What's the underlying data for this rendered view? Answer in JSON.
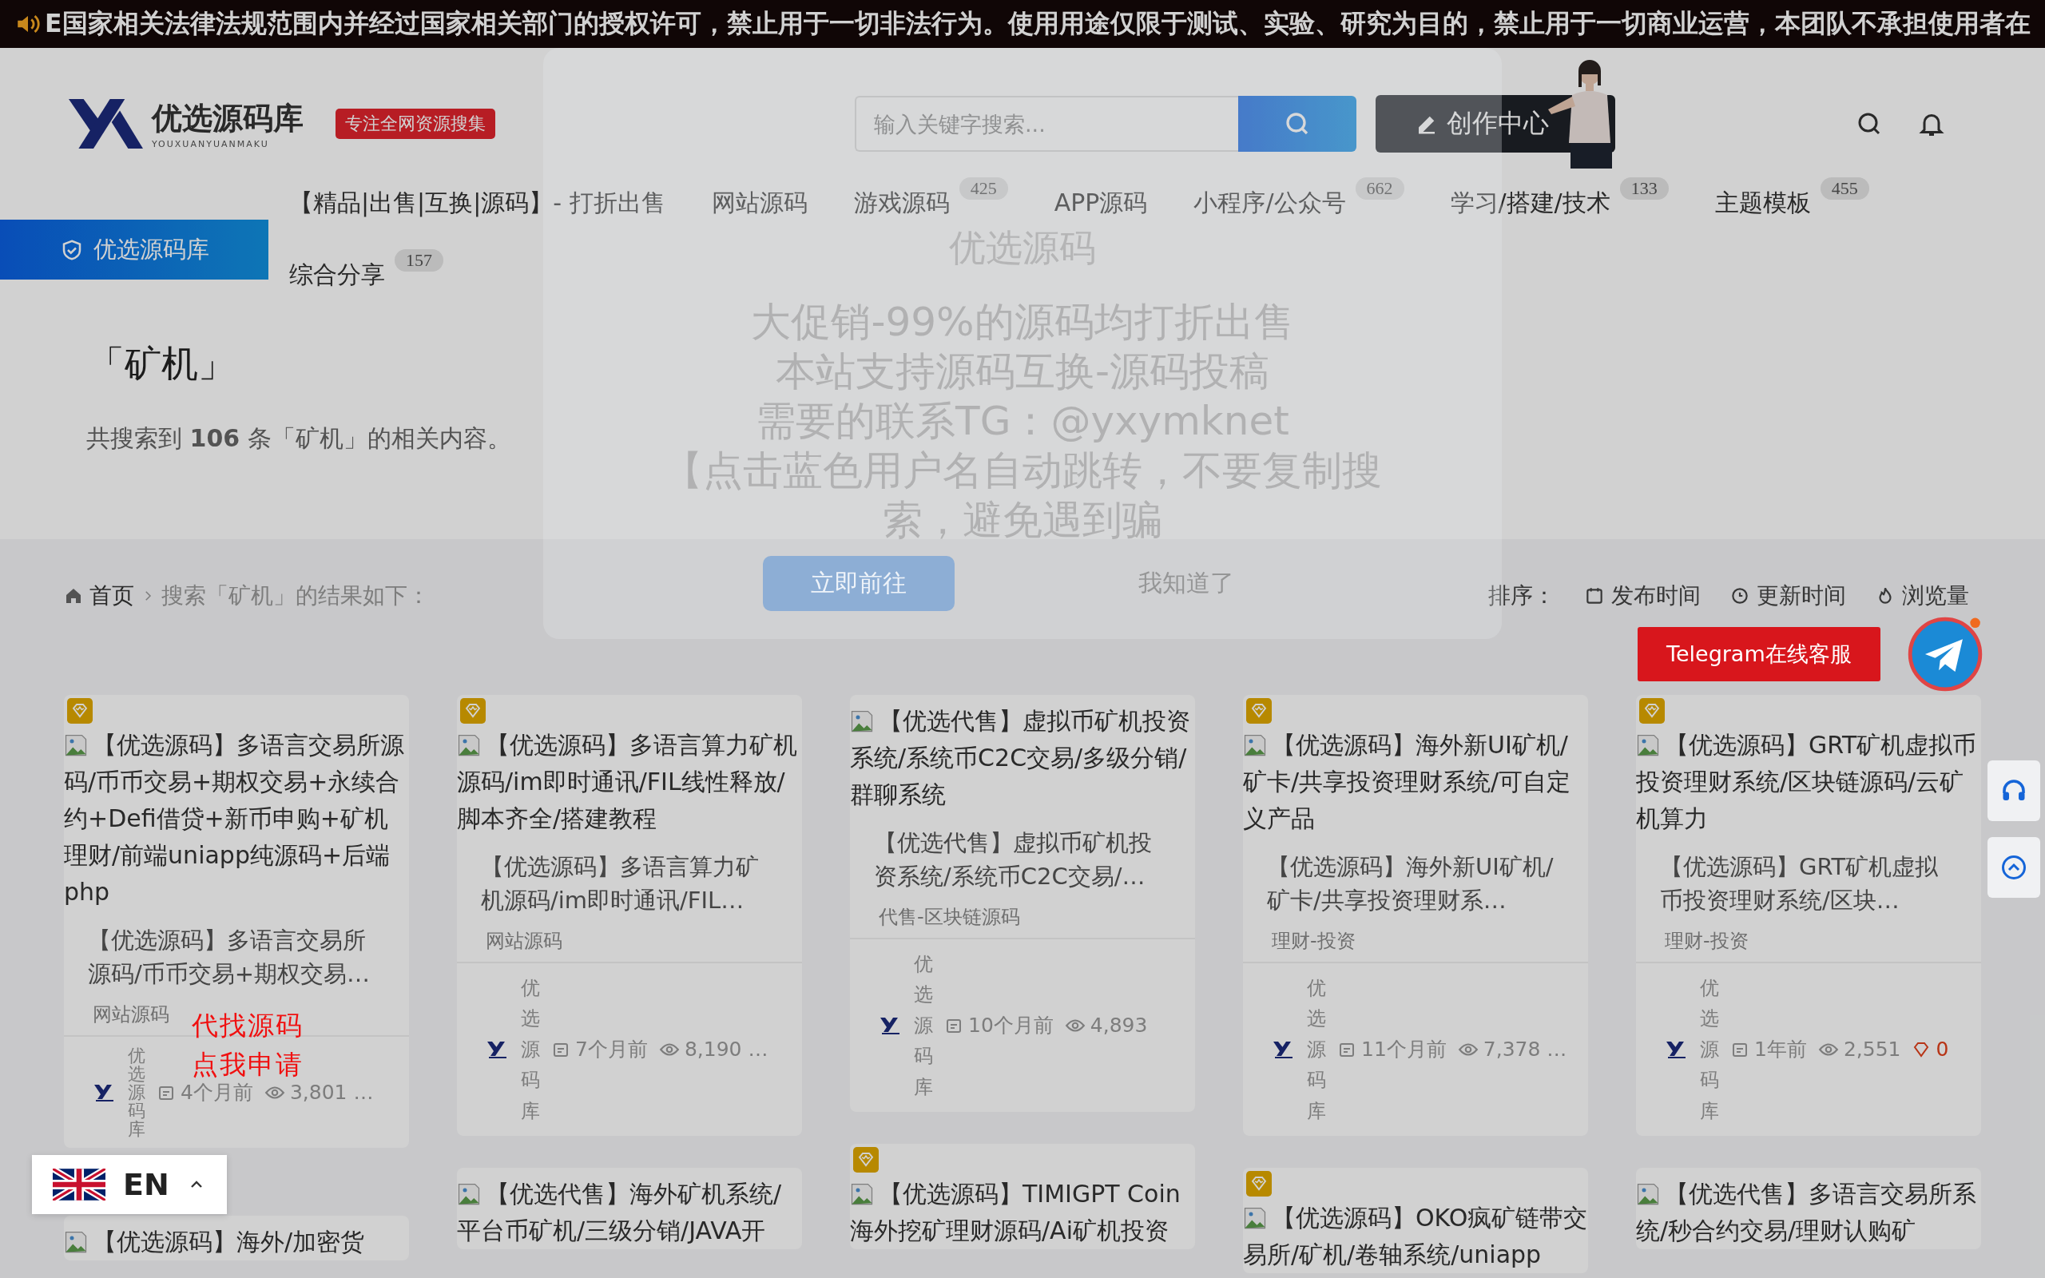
{
  "ticker": {
    "text": "E国家相关法律法规范围内并经过国家相关部门的授权许可，禁止用于一切非法行为。使用用途仅限于测试、实验、研究为目的，禁止用于一切商业运营，本团队不承担使用者在"
  },
  "header": {
    "logo": {
      "name": "优选源码库",
      "subtitle": "YOUXUANYUANMAKU"
    },
    "tag": "专注全网资源搜集",
    "search": {
      "placeholder": "输入关键字搜索..."
    },
    "create_button": "创作中心"
  },
  "side_tab": {
    "label": "优选源码库"
  },
  "nav": [
    {
      "label": "【精品|出售|互换|源码】- 打折出售"
    },
    {
      "label": "网站源码"
    },
    {
      "label": "游戏源码",
      "count": "425"
    },
    {
      "label": "APP源码"
    },
    {
      "label": "小程序/公众号",
      "count": "662"
    },
    {
      "label": "学习/搭建/技术",
      "count": "133"
    },
    {
      "label": "主题模板",
      "count": "455"
    },
    {
      "label": "综合分享",
      "count": "157"
    }
  ],
  "search_result": {
    "title": "「矿机」",
    "summary": "共搜索到 **106** 条「矿机」的相关内容。"
  },
  "breadcrumb": [
    "首页",
    "搜索「矿机」的结果如下："
  ],
  "sort": {
    "label": "排序：",
    "options": [
      {
        "label": "发布时间",
        "kind": "calendar"
      },
      {
        "label": "更新时间",
        "kind": "clock"
      },
      {
        "label": "浏览量",
        "kind": "flame"
      }
    ]
  },
  "cards": [
    {
      "title": "【优选源码】多语言交易所源码/币币交易+期权交易+永续合约+Defi借贷+新币申购+矿机理财/前端uniapp纯源码+后端php",
      "vip": true,
      "excerpt": "【优选源码】多语言交易所源码/币币交易+期权交易…",
      "category": "网站源码",
      "author": "优选源码库",
      "date": "4个月前",
      "views": "3,801 …"
    },
    {
      "title": "【优选源码】多语言算力矿机源码/im即时通讯/FIL线性释放/脚本齐全/搭建教程",
      "vip": true,
      "excerpt": "【优选源码】多语言算力矿机源码/im即时通讯/FIL…",
      "category": "网站源码",
      "author": "优选源码库",
      "date": "7个月前",
      "views": "8,190 …"
    },
    {
      "title": "【优选代售】虚拟币矿机投资系统/系统币C2C交易/多级分销/群聊系统",
      "vip": false,
      "excerpt": "【优选代售】虚拟币矿机投资系统/系统币C2C交易/…",
      "category": "代售-区块链源码",
      "author": "优选源码库",
      "date": "10个月前",
      "views": "4,893"
    },
    {
      "title": "【优选源码】海外新UI矿机/矿卡/共享投资理财系统/可自定义产品",
      "vip": true,
      "excerpt": "【优选源码】海外新UI矿机/矿卡/共享投资理财系…",
      "category": "理财-投资",
      "author": "优选源码库",
      "date": "11个月前",
      "views": "7,378 …"
    },
    {
      "title": "【优选源码】GRT矿机虚拟币投资理财系统/区块链源码/云矿机算力",
      "vip": true,
      "excerpt": "【优选源码】GRT矿机虚拟币投资理财系统/区块…",
      "category": "理财-投资",
      "author": "优选源码库",
      "date": "1年前",
      "views": "2,551",
      "likes": "0"
    },
    {
      "title": "【优选源码】海外/加密货",
      "vip": false
    },
    {
      "title": "【优选代售】海外矿机系统/平台币矿机/三级分销/JAVA开",
      "vip": false
    },
    {
      "title": "【优选源码】TIMIGPT Coin海外挖矿理财源码/Ai矿机投资",
      "vip": true
    },
    {
      "title": "【优选源码】OKO疯矿链带交易所/矿机/卷轴系统/uniapp",
      "vip": true
    },
    {
      "title": "【优选代售】多语言交易所系统/秒合约交易/理财认购矿",
      "vip": false
    }
  ],
  "modal": {
    "title": "优选源码",
    "lines": [
      "大促销-99%的源码均打折出售",
      "本站支持源码互换-源码投稿",
      "需要的联系TG：@yxymknet",
      "【点击蓝色用户名自动跳转，不要复制搜索，避免遇到骗"
    ],
    "buttons": [
      "立即前往",
      "我知道了"
    ]
  },
  "floating": {
    "telegram_label": "Telegram在线客服",
    "promo": [
      "代找源码",
      "点我申请"
    ],
    "language": "EN"
  }
}
